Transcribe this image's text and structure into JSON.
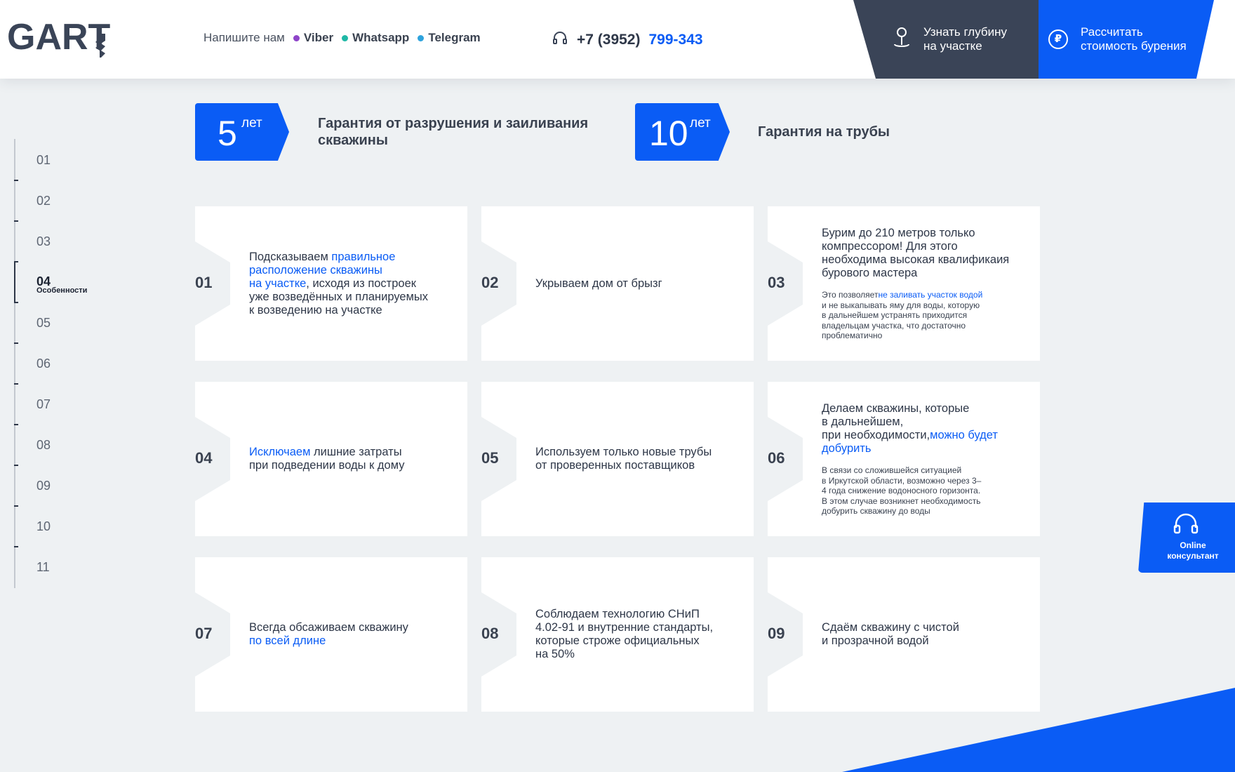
{
  "header": {
    "logo_text": "GART",
    "contact_prompt": "Напишите нам",
    "messengers": [
      {
        "label": "Viber",
        "color": "#8e44c9"
      },
      {
        "label": "Whatsapp",
        "color": "#1fb8a6"
      },
      {
        "label": "Telegram",
        "color": "#2ea3dd"
      }
    ],
    "phone_prefix": "+7 (3952)",
    "phone_number": "799-343",
    "btn_depth": {
      "line1": "Узнать глубину",
      "line2": "на участке"
    },
    "btn_calc": {
      "line1": "Рассчитать",
      "line2": "стоимость бурения"
    },
    "currency_symbol": "₽"
  },
  "sidenav": {
    "items": [
      "01",
      "02",
      "03",
      "04",
      "05",
      "06",
      "07",
      "08",
      "09",
      "10",
      "11"
    ],
    "active": "04",
    "active_label": "Особенности"
  },
  "guarantees": [
    {
      "num": "5",
      "unit": "лет",
      "line1": "Гарантия от разрушения и заиливания",
      "line2": "скважины"
    },
    {
      "num": "10",
      "unit": "лет",
      "line1": "Гарантия на трубы",
      "line2": ""
    }
  ],
  "cards": [
    {
      "num": "01",
      "lines": [
        {
          "pre": "Подсказываем ",
          "blue": "правильное",
          "post": ""
        },
        {
          "pre": "",
          "blue": "расположение скважины",
          "post": ""
        },
        {
          "pre": "",
          "blue": "на участке",
          "post": ", исходя из построек"
        },
        {
          "pre": "уже возведённых и планируемых",
          "blue": "",
          "post": ""
        },
        {
          "pre": "к возведению на участке",
          "blue": "",
          "post": ""
        }
      ]
    },
    {
      "num": "02",
      "lines": [
        {
          "pre": "Укрываем дом от брызг",
          "blue": "",
          "post": ""
        }
      ]
    },
    {
      "num": "03",
      "lines": [
        {
          "pre": "Бурим до 210 метров только",
          "blue": "",
          "post": ""
        },
        {
          "pre": "компрессором! Для этого",
          "blue": "",
          "post": ""
        },
        {
          "pre": "необходима высокая квалификаия",
          "blue": "",
          "post": ""
        },
        {
          "pre": "бурового мастера",
          "blue": "",
          "post": ""
        }
      ],
      "small": [
        {
          "pre": "Это позволяет",
          "blue": "не заливать участок водой",
          "post": ""
        },
        {
          "pre": "и не выкапывать яму для воды, которую",
          "blue": "",
          "post": ""
        },
        {
          "pre": "в дальнейшем устранять приходится",
          "blue": "",
          "post": ""
        },
        {
          "pre": "владельцам участка, что достаточно",
          "blue": "",
          "post": ""
        },
        {
          "pre": "проблематично",
          "blue": "",
          "post": ""
        }
      ]
    },
    {
      "num": "04",
      "lines": [
        {
          "pre": "",
          "blue": "Исключаем",
          "post": " лишние затраты"
        },
        {
          "pre": "при подведении воды к дому",
          "blue": "",
          "post": ""
        }
      ]
    },
    {
      "num": "05",
      "lines": [
        {
          "pre": "Используем только новые трубы",
          "blue": "",
          "post": ""
        },
        {
          "pre": "от проверенных поставщиков",
          "blue": "",
          "post": ""
        }
      ]
    },
    {
      "num": "06",
      "lines": [
        {
          "pre": "Делаем скважины, которые",
          "blue": "",
          "post": ""
        },
        {
          "pre": "в дальнейшем,",
          "blue": "",
          "post": ""
        },
        {
          "pre": "при необходимости,",
          "blue": "можно будет",
          "post": ""
        },
        {
          "pre": "",
          "blue": "добурить",
          "post": ""
        }
      ],
      "small": [
        {
          "pre": "В связи со сложившейся ситуацией",
          "blue": "",
          "post": ""
        },
        {
          "pre": "в Иркутской области, возможно через 3–",
          "blue": "",
          "post": ""
        },
        {
          "pre": "4 года снижение водоносного горизонта.",
          "blue": "",
          "post": ""
        },
        {
          "pre": "В этом случае возникнет необходимость",
          "blue": "",
          "post": ""
        },
        {
          "pre": "добурить скважину до воды",
          "blue": "",
          "post": ""
        }
      ]
    },
    {
      "num": "07",
      "lines": [
        {
          "pre": "Всегда обсаживаем скважину",
          "blue": "",
          "post": ""
        },
        {
          "pre": "",
          "blue": "по всей длине",
          "post": ""
        }
      ]
    },
    {
      "num": "08",
      "lines": [
        {
          "pre": "Соблюдаем технологию СНиП",
          "blue": "",
          "post": ""
        },
        {
          "pre": "4.02-91 и внутренние стандарты,",
          "blue": "",
          "post": ""
        },
        {
          "pre": "которые строже официальных",
          "blue": "",
          "post": ""
        },
        {
          "pre": "на 50%",
          "blue": "",
          "post": ""
        }
      ]
    },
    {
      "num": "09",
      "lines": [
        {
          "pre": "Сдаём скважину с чистой",
          "blue": "",
          "post": ""
        },
        {
          "pre": "и прозрачной водой",
          "blue": "",
          "post": ""
        }
      ]
    }
  ],
  "consultant": {
    "line1": "Online",
    "line2": "консультант"
  },
  "colors": {
    "accent": "#0a5cf5",
    "dark": "#3a4457",
    "bg": "#eef1f3"
  }
}
